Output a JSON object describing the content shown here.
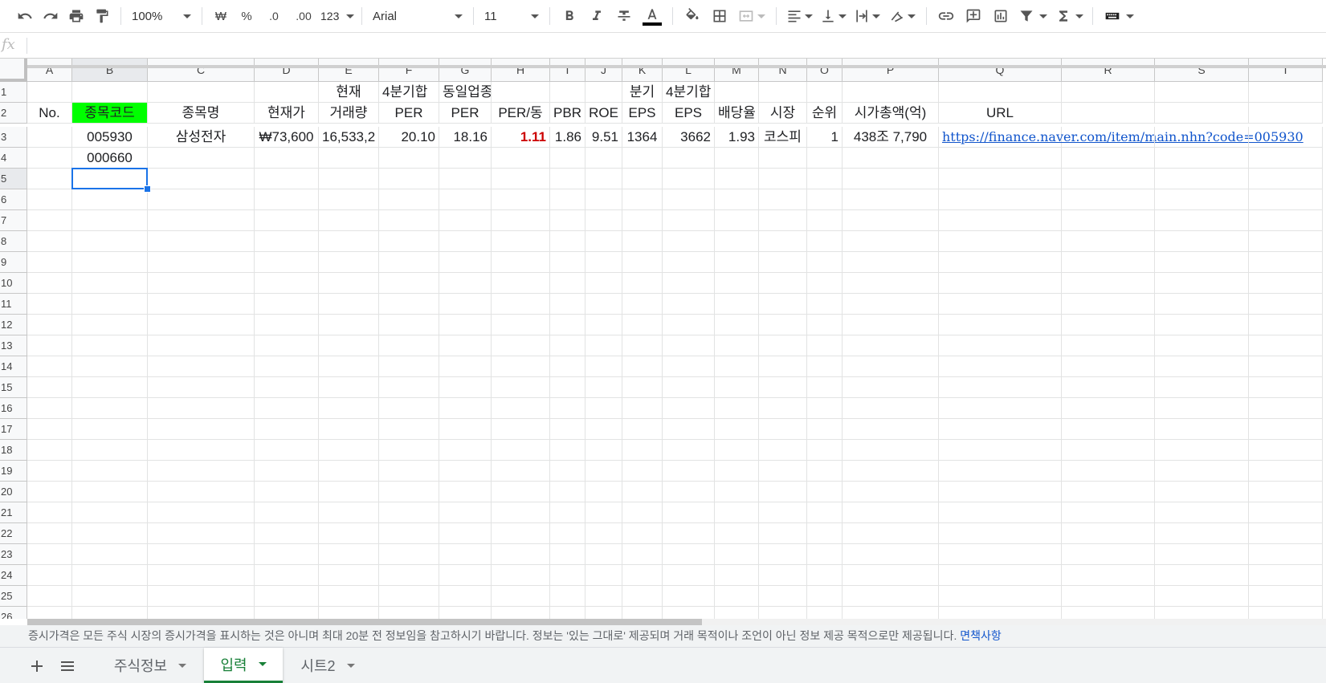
{
  "toolbar": {
    "zoom": "100%",
    "currency": "₩",
    "percent": "%",
    "decrease_decimal": ".0",
    "increase_decimal": ".00",
    "more_formats": "123",
    "font": "Arial",
    "font_size": "11",
    "text_color_bar": "#000000"
  },
  "formula_bar": {
    "fx": "fx",
    "value": ""
  },
  "columns": [
    "A",
    "B",
    "C",
    "D",
    "E",
    "F",
    "G",
    "H",
    "I",
    "J",
    "K",
    "L",
    "M",
    "N",
    "O",
    "P",
    "Q",
    "R",
    "S",
    "T"
  ],
  "rows": [
    "1",
    "2",
    "3",
    "4",
    "5",
    "6",
    "7",
    "8",
    "9",
    "10",
    "11",
    "12",
    "13",
    "14",
    "15",
    "16",
    "17",
    "18",
    "19",
    "20",
    "21",
    "22",
    "23",
    "24",
    "25",
    "26"
  ],
  "cells": {
    "E1": "현재",
    "F1": "4분기합",
    "G1": "동일업종",
    "K1": "분기",
    "L1": "4분기합",
    "A2": "No.",
    "B2": "종목코드",
    "C2": "종목명",
    "D2": "현재가",
    "E2": "거래량",
    "F2": "PER",
    "G2": "PER",
    "H2": "PER/동",
    "I2": "PBR",
    "J2": "ROE",
    "K2": "EPS",
    "L2": "EPS",
    "M2": "배당율",
    "N2": "시장",
    "O2": "순위",
    "P2": "시가총액(억)",
    "Q2": "URL",
    "B3": "005930",
    "C3": "삼성전자",
    "D3": "₩73,600",
    "E3": "16,533,2",
    "F3": "20.10",
    "G3": "18.16",
    "H3": "1.11",
    "I3": "1.86",
    "J3": "9.51",
    "K3": "1364",
    "L3": "3662",
    "M3": "1.93",
    "N3": "코스피",
    "O3": "1",
    "P3": "438조 7,790",
    "Q3": "https://finance.naver.com/item/main.nhn?code=005930",
    "B4": "000660"
  },
  "colors": {
    "header_fill": "#00ff00",
    "negative_red": "#cc0000",
    "link_blue": "#1155cc",
    "selection_blue": "#1a73e8",
    "active_tab_green": "#188038"
  },
  "disclaimer": {
    "text": "증시가격은 모든 주식 시장의 증시가격을 표시하는 것은 아니며 최대 20분 전 정보임을 참고하시기 바랍니다. 정보는 '있는 그대로' 제공되며 거래 목적이나 조언이 아닌 정보 제공 목적으로만 제공됩니다.",
    "link": "면책사항"
  },
  "sheets": [
    {
      "label": "주식정보",
      "active": false
    },
    {
      "label": "입력",
      "active": true
    },
    {
      "label": "시트2",
      "active": false
    }
  ]
}
